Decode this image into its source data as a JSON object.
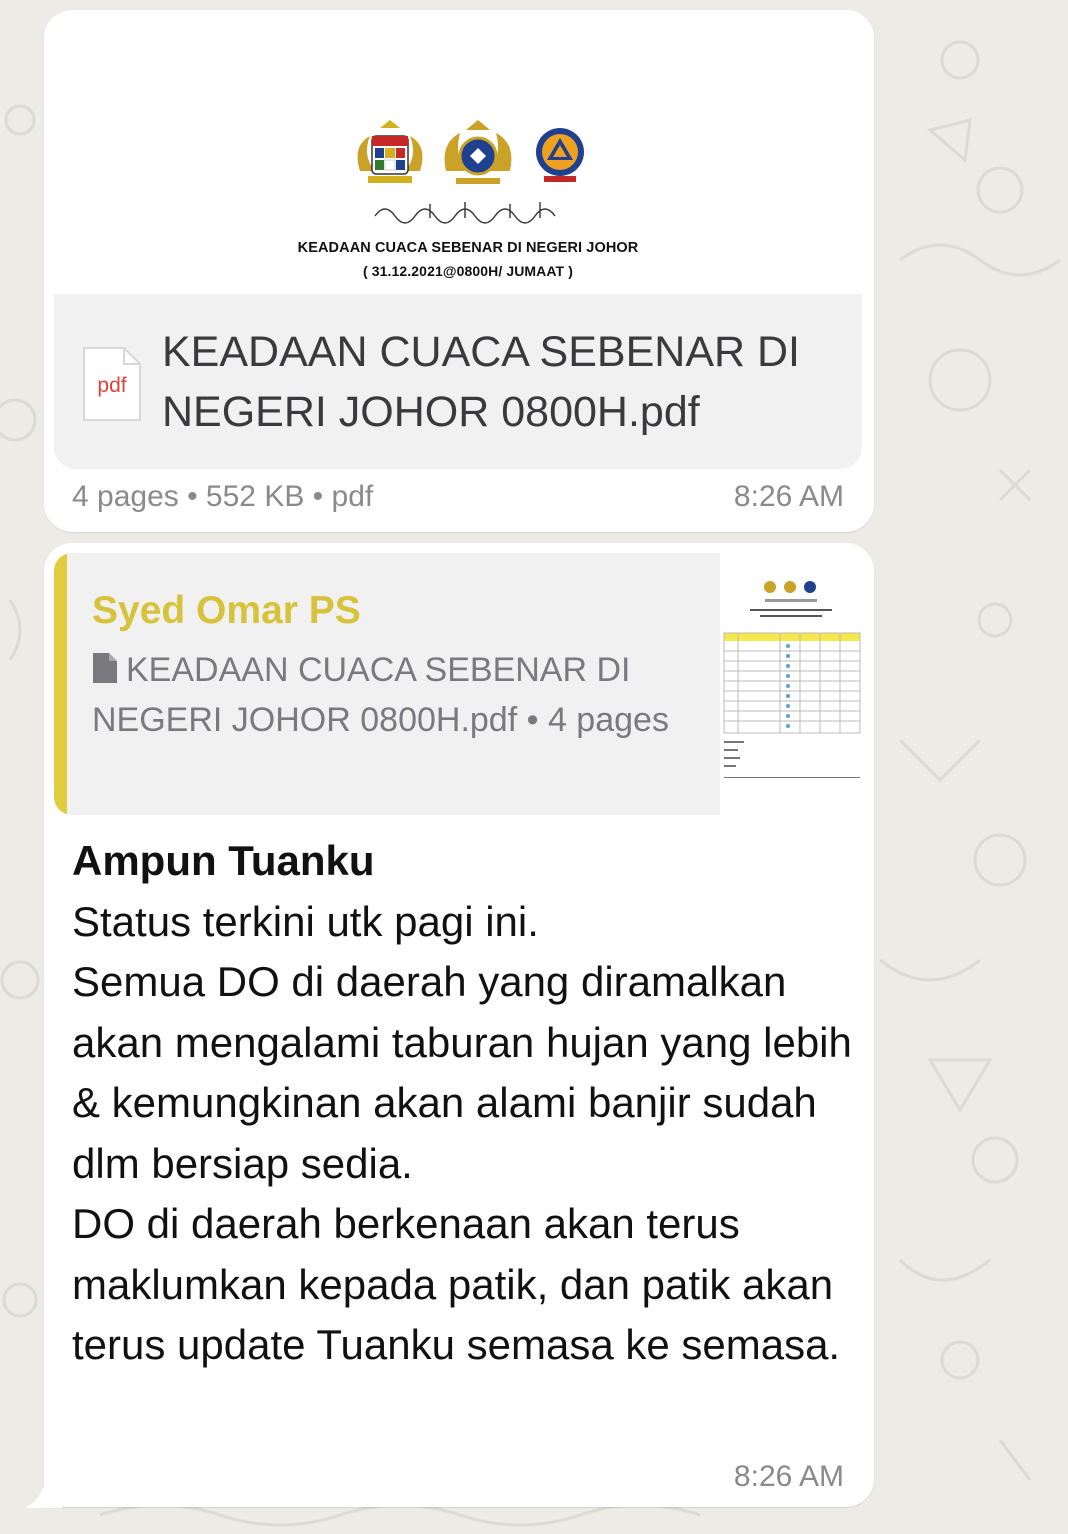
{
  "colors": {
    "wallpaper": "#ecebe6",
    "bubble": "#ffffff",
    "file_box": "#f1f1f2",
    "quote_accent": "#e1cc3f",
    "sender_name": "#d7c23b",
    "pdf_red": "#d9453a",
    "meta_gray": "#8a8a8e"
  },
  "document_message": {
    "preview": {
      "arabic_greeting": "السلام عليكم ورحمة الله وبركاته",
      "title_line_1": "KEADAAN CUACA SEBENAR DI NEGERI JOHOR",
      "title_line_2": "( 31.12.2021@0800H/ JUMAAT )",
      "logos": [
        "malaysia-coat-of-arms",
        "johor-coat-of-arms",
        "civil-defence-emblem"
      ]
    },
    "file_icon_label": "pdf",
    "file_name": "KEADAAN CUACA SEBENAR DI NEGERI JOHOR 0800H.pdf",
    "meta": "4 pages • 552 KB • pdf",
    "time": "8:26 AM"
  },
  "reply_message": {
    "quote": {
      "sender": "Syed Omar PS",
      "text": "KEADAAN CUACA SEBENAR DI NEGERI JOHOR 0800H.pdf • 4 pages",
      "icon": "document-icon"
    },
    "greeting": "Ampun Tuanku",
    "body": "Status terkini utk pagi ini.\nSemua DO di daerah yang diramalkan akan mengalami taburan hujan yang lebih & kemungkinan akan alami banjir sudah dlm bersiap sedia.\nDO di daerah berkenaan akan terus maklumkan kepada patik, dan patik akan terus update Tuanku semasa ke semasa.",
    "time": "8:26 AM"
  }
}
